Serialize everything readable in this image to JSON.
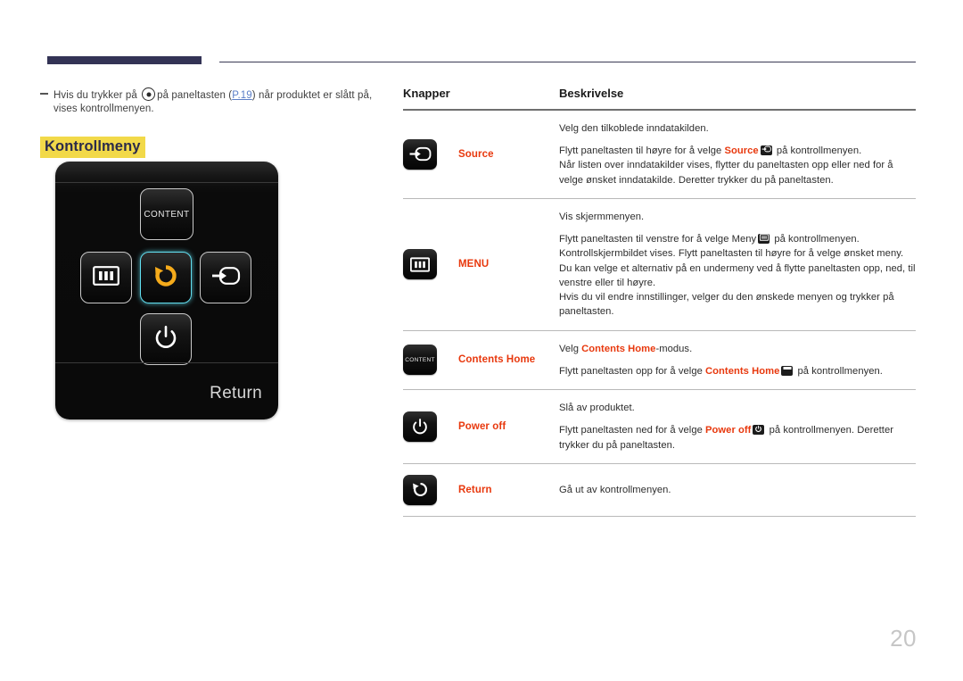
{
  "page": {
    "number": "20"
  },
  "note": {
    "text_before": "Hvis du trykker på",
    "text_mid": "på paneltasten (",
    "link": "P.19",
    "text_after": ") når produktet er slått på, vises kontrollmenyen."
  },
  "section": {
    "title": "Kontrollmeny"
  },
  "osd": {
    "keys": {
      "content": "CONTENT",
      "menu": "menu-icon",
      "return": "return-icon",
      "source": "source-icon",
      "power": "power-icon"
    },
    "footer_label": "Return"
  },
  "table": {
    "headers": {
      "buttons": "Knapper",
      "description": "Beskrivelse"
    },
    "rows": [
      {
        "icon": "source-icon",
        "name": "Source",
        "desc_1": "Velg den tilkoblede inndatakilden.",
        "desc_2_a": "Flytt paneltasten til høyre for å velge ",
        "desc_2_b": "Source",
        "desc_2_c": " på kontrollmenyen.",
        "desc_2_d": "Når listen over inndatakilder vises, flytter du paneltasten opp eller ned for å velge ønsket inndatakilde. Deretter trykker du på paneltasten."
      },
      {
        "icon": "menu-icon",
        "name": "MENU",
        "desc_1": "Vis skjermmenyen.",
        "desc_2_a": "Flytt paneltasten til venstre for å velge Meny",
        "desc_2_c": " på kontrollmenyen.",
        "desc_2_d": "Kontrollskjermbildet vises. Flytt paneltasten til høyre for å velge ønsket meny. Du kan velge et alternativ på en undermeny ved å flytte paneltasten opp, ned, til venstre eller til høyre.",
        "desc_2_e": "Hvis du vil endre innstillinger, velger du den ønskede menyen og trykker på paneltasten."
      },
      {
        "icon": "content-icon",
        "name": "Contents Home",
        "desc_1_a": "Velg ",
        "desc_1_b": "Contents Home",
        "desc_1_c": "-modus.",
        "desc_2_a": "Flytt paneltasten opp for å velge ",
        "desc_2_b": "Contents Home",
        "desc_2_c": " på kontrollmenyen."
      },
      {
        "icon": "power-icon",
        "name": "Power off",
        "desc_1": "Slå av produktet.",
        "desc_2_a": "Flytt paneltasten ned for å velge ",
        "desc_2_b": "Power off",
        "desc_2_c": " på kontrollmenyen. Deretter trykker du på paneltasten."
      },
      {
        "icon": "return-icon",
        "name": "Return",
        "desc_1": "Gå ut av kontrollmenyen."
      }
    ]
  },
  "colors": {
    "accent_red": "#e8380d",
    "highlight_yellow": "#f2d949",
    "navy": "#333355",
    "link_blue": "#5b7fc7",
    "highlight_cyan": "#62dff0",
    "return_arrow_orange": "#f5ab1b"
  }
}
